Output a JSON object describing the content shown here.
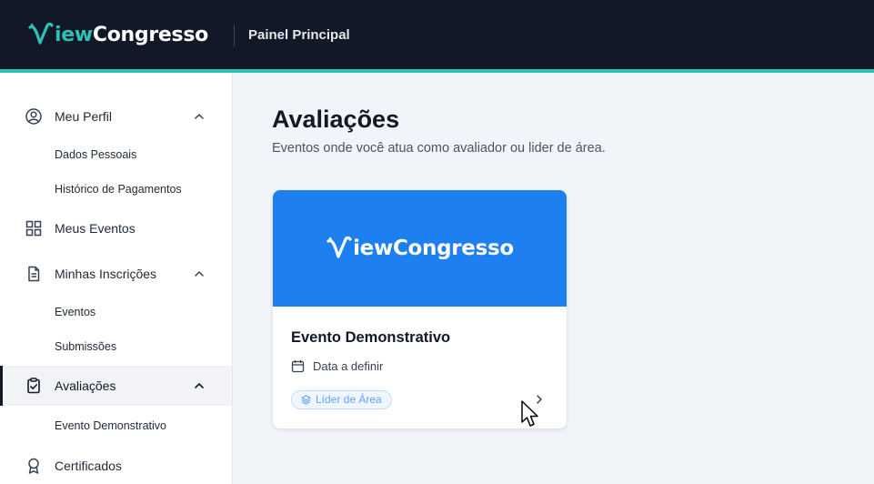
{
  "header": {
    "logo": {
      "part1": "iew",
      "part2": "Congresso"
    },
    "title": "Painel Principal"
  },
  "sidebar": {
    "items": [
      {
        "label": "Meu Perfil",
        "icon": "user-circle-icon",
        "expanded": true,
        "subitems": [
          "Dados Pessoais",
          "Histórico de Pagamentos"
        ]
      },
      {
        "label": "Meus Eventos",
        "icon": "grid-icon"
      },
      {
        "label": "Minhas Inscrições",
        "icon": "document-icon",
        "expanded": true,
        "subitems": [
          "Eventos",
          "Submissões"
        ]
      },
      {
        "label": "Avaliações",
        "icon": "clipboard-check-icon",
        "expanded": true,
        "active": true,
        "subitems": [
          "Evento Demonstrativo"
        ]
      },
      {
        "label": "Certificados",
        "icon": "award-icon"
      }
    ]
  },
  "main": {
    "title": "Avaliações",
    "subtitle": "Eventos onde você atua como avaliador ou lider de área.",
    "cards": [
      {
        "banner_logo": {
          "part1": "iew",
          "part2": "Congresso"
        },
        "title": "Evento Demonstrativo",
        "date": "Data a definir",
        "badge": "Líder de Área"
      }
    ]
  },
  "colors": {
    "header_bg": "#111827",
    "accent_teal": "#2dc0b4",
    "banner_blue": "#1e7ff0",
    "badge_text": "#60a5fa"
  }
}
